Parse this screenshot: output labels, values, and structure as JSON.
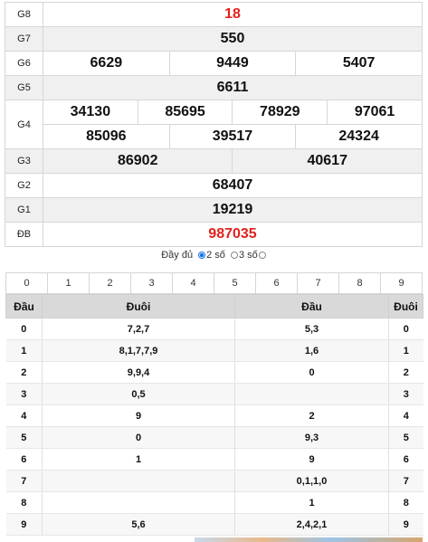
{
  "prizes": [
    {
      "label": "G8",
      "numbers": [
        "18"
      ],
      "red": true
    },
    {
      "label": "G7",
      "numbers": [
        "550"
      ]
    },
    {
      "label": "G6",
      "numbers": [
        "6629",
        "9449",
        "5407"
      ]
    },
    {
      "label": "G5",
      "numbers": [
        "6611"
      ]
    },
    {
      "label": "G4",
      "row1": [
        "34130",
        "85695",
        "78929",
        "97061"
      ],
      "row2": [
        "85096",
        "39517",
        "24324"
      ]
    },
    {
      "label": "G3",
      "numbers": [
        "86902",
        "40617"
      ]
    },
    {
      "label": "G2",
      "numbers": [
        "68407"
      ]
    },
    {
      "label": "G1",
      "numbers": [
        "19219"
      ]
    },
    {
      "label": "ĐB",
      "numbers": [
        "987035"
      ],
      "red": true
    }
  ],
  "filter": {
    "options": [
      {
        "label": "Đầy đủ",
        "selected": false
      },
      {
        "label": "2 số",
        "selected": true
      },
      {
        "label": "3 số",
        "selected": false
      }
    ]
  },
  "digits": [
    "0",
    "1",
    "2",
    "3",
    "4",
    "5",
    "6",
    "7",
    "8",
    "9"
  ],
  "loto": {
    "headers": [
      "Đầu",
      "Đuôi",
      "Đầu",
      "Đuôi"
    ],
    "rows": [
      {
        "head": "0",
        "tails": "7,2,7",
        "heads": "5,3",
        "tail": "0"
      },
      {
        "head": "1",
        "tails": "8,1,7,7,9",
        "heads": "1,6",
        "tail": "1"
      },
      {
        "head": "2",
        "tails": "9,9,4",
        "heads": "0",
        "tail": "2"
      },
      {
        "head": "3",
        "tails": "0,5",
        "heads": "",
        "tail": "3"
      },
      {
        "head": "4",
        "tails": "9",
        "heads": "2",
        "tail": "4"
      },
      {
        "head": "5",
        "tails": "0",
        "heads": "9,3",
        "tail": "5"
      },
      {
        "head": "6",
        "tails": "1",
        "heads": "9",
        "tail": "6"
      },
      {
        "head": "7",
        "tails": "",
        "heads": "0,1,1,0",
        "tail": "7"
      },
      {
        "head": "8",
        "tails": "",
        "heads": "1",
        "tail": "8"
      },
      {
        "head": "9",
        "tails": "5,6",
        "heads": "2,4,2,1",
        "tail": "9"
      }
    ]
  },
  "colors": {
    "red": "#e2211c",
    "header_bg": "#d9d9d9",
    "radio_selected": "#1a73e8"
  }
}
